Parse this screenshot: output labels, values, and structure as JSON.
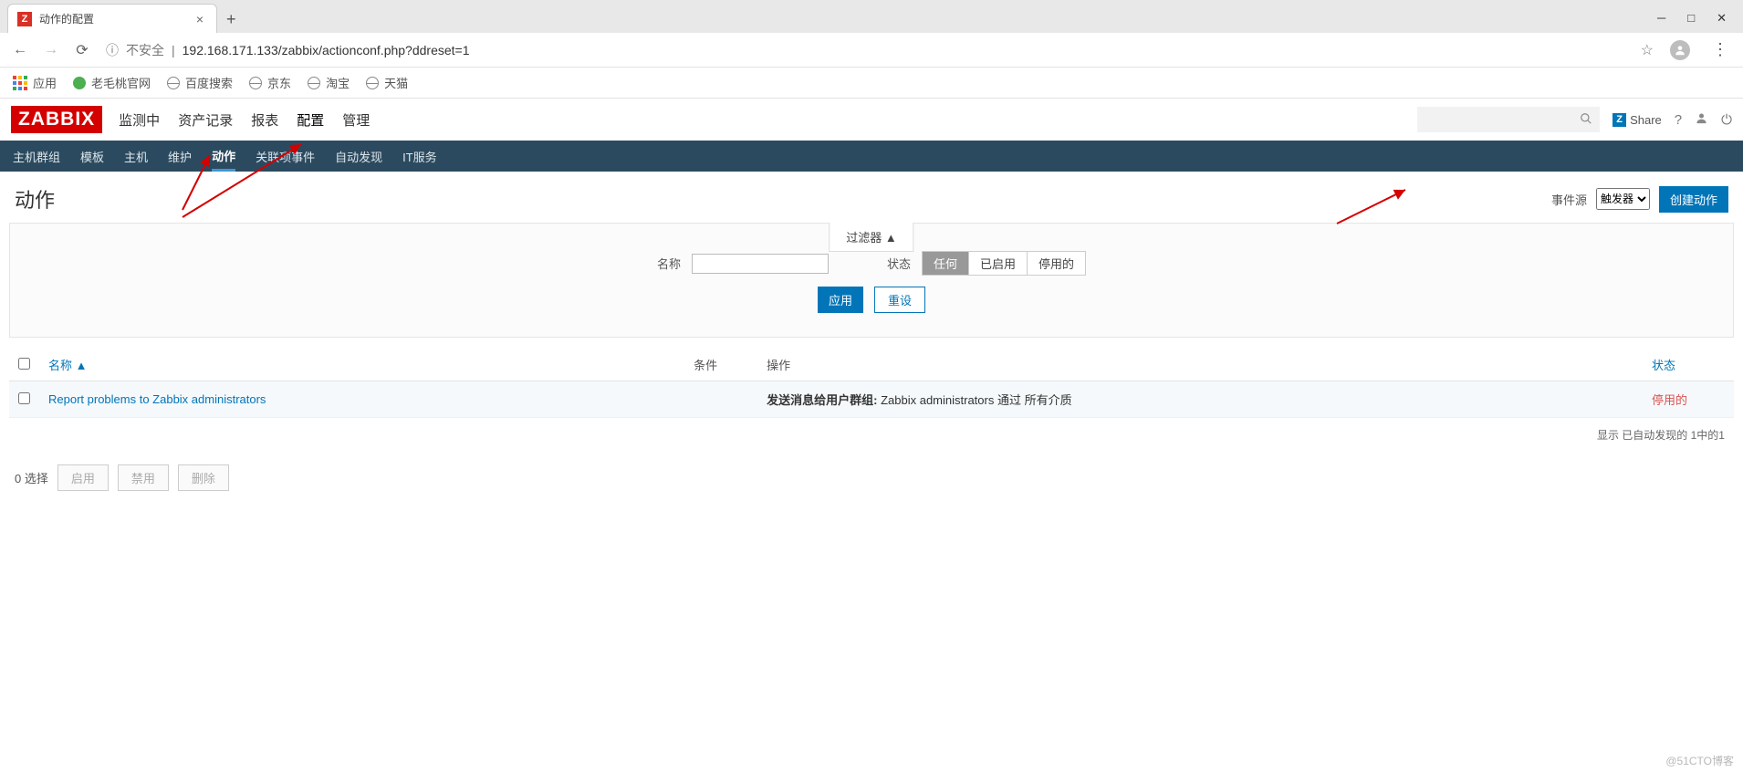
{
  "browser": {
    "tab_favicon": "Z",
    "tab_title": "动作的配置",
    "url_insecure_label": "不安全",
    "url": "192.168.171.133/zabbix/actionconf.php?ddreset=1",
    "bookmarks": {
      "apps": "应用",
      "items": [
        "老毛桃官网",
        "百度搜索",
        "京东",
        "淘宝",
        "天猫"
      ]
    }
  },
  "zabbix": {
    "logo": "ZABBIX",
    "topnav": [
      "监测中",
      "资产记录",
      "报表",
      "配置",
      "管理"
    ],
    "topnav_active": "配置",
    "share_label": "Share",
    "subnav": [
      "主机群组",
      "模板",
      "主机",
      "维护",
      "动作",
      "关联项事件",
      "自动发现",
      "IT服务"
    ],
    "subnav_active": "动作"
  },
  "page": {
    "title": "动作",
    "event_source_label": "事件源",
    "event_source_value": "触发器",
    "create_button": "创建动作",
    "filter_tab": "过滤器 ▲",
    "filter_name_label": "名称",
    "filter_status_label": "状态",
    "status_options": {
      "any": "任何",
      "enabled": "已启用",
      "disabled": "停用的"
    },
    "apply_button": "应用",
    "reset_button": "重设",
    "table": {
      "headers": {
        "name": "名称 ▲",
        "conditions": "条件",
        "operations": "操作",
        "status": "状态"
      },
      "rows": [
        {
          "name": "Report problems to Zabbix administrators",
          "conditions": "",
          "operation_prefix": "发送消息给用户群组:",
          "operation_rest": " Zabbix administrators 通过 所有介质",
          "status": "停用的"
        }
      ],
      "footer": "显示 已自动发现的 1中的1"
    },
    "bulk": {
      "selected": "0 选择",
      "enable": "启用",
      "disable": "禁用",
      "delete": "删除"
    }
  },
  "watermark": "@51CTO博客"
}
